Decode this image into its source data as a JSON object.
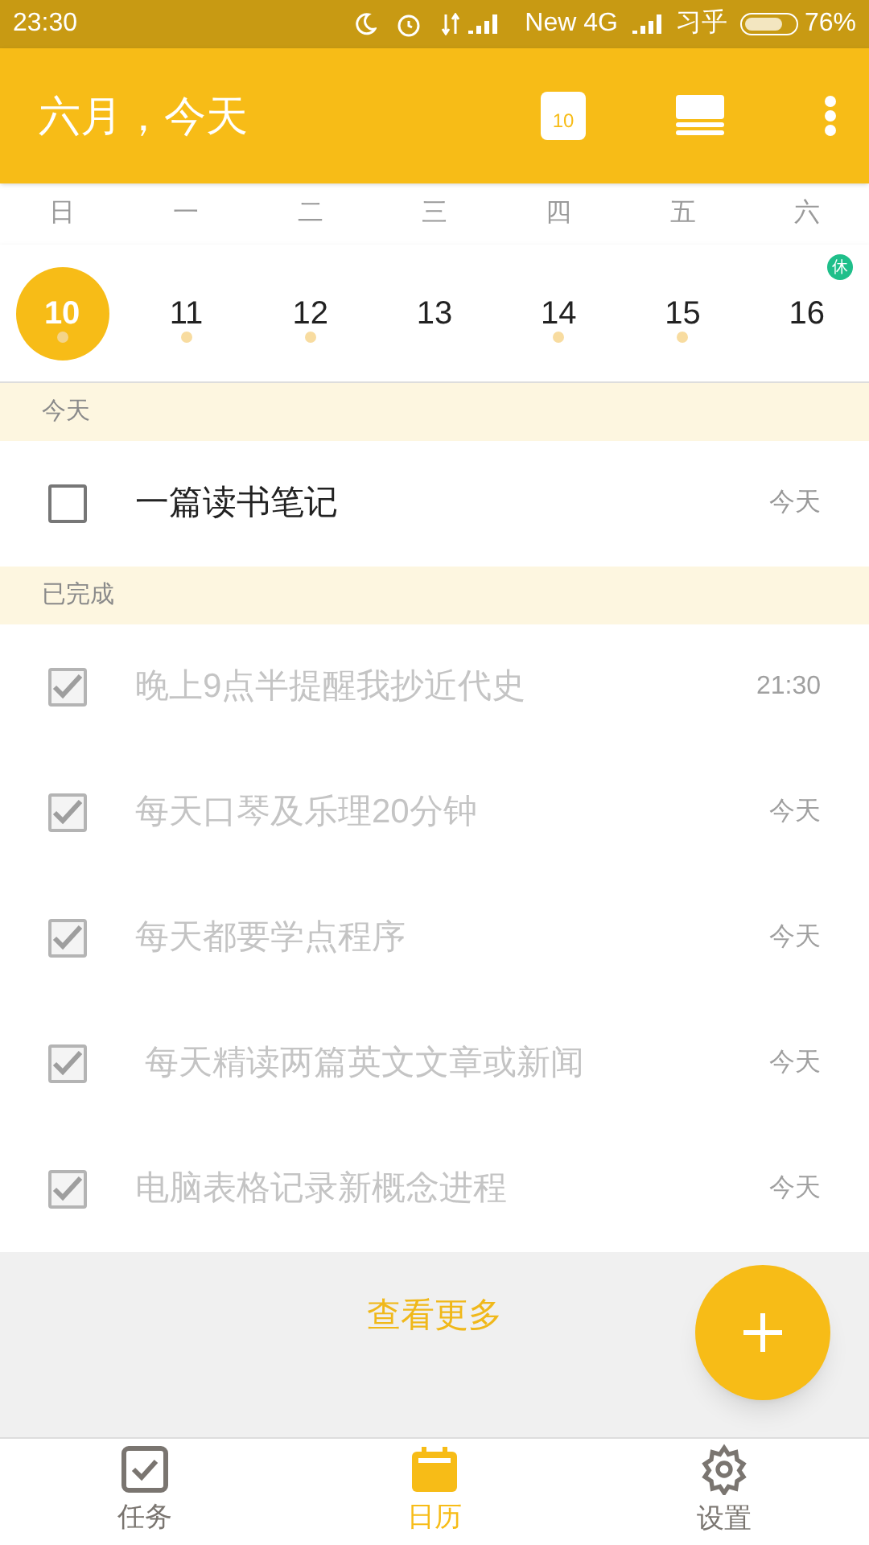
{
  "status_bar": {
    "time": "23:30",
    "network": "New 4G",
    "carrier": "习乎",
    "battery": "76%"
  },
  "header": {
    "title": "六月，今天",
    "calendar_day": "10"
  },
  "week": {
    "weekdays": [
      "日",
      "一",
      "二",
      "三",
      "四",
      "五",
      "六"
    ],
    "days": [
      {
        "date": "10",
        "selected": true,
        "has_tasks": true
      },
      {
        "date": "11",
        "selected": false,
        "has_tasks": true
      },
      {
        "date": "12",
        "selected": false,
        "has_tasks": true
      },
      {
        "date": "13",
        "selected": false,
        "has_tasks": false
      },
      {
        "date": "14",
        "selected": false,
        "has_tasks": true
      },
      {
        "date": "15",
        "selected": false,
        "has_tasks": true
      },
      {
        "date": "16",
        "selected": false,
        "has_tasks": false,
        "badge": "休"
      }
    ]
  },
  "sections": [
    {
      "title": "今天",
      "tasks": [
        {
          "text": "一篇读书笔记",
          "time": "今天",
          "checked": false
        }
      ]
    },
    {
      "title": "已完成",
      "tasks": [
        {
          "text": "晚上9点半提醒我抄近代史",
          "time": "21:30",
          "checked": true
        },
        {
          "text": "每天口琴及乐理20分钟",
          "time": "今天",
          "checked": true
        },
        {
          "text": "每天都要学点程序",
          "time": "今天",
          "checked": true
        },
        {
          "text": " 每天精读两篇英文文章或新闻",
          "time": "今天",
          "checked": true
        },
        {
          "text": "电脑表格记录新概念进程",
          "time": "今天",
          "checked": true
        }
      ]
    }
  ],
  "more_link": "查看更多",
  "bottom_nav": [
    {
      "label": "任务",
      "kind": "tasks",
      "selected": false
    },
    {
      "label": "日历",
      "kind": "calendar",
      "selected": true
    },
    {
      "label": "设置",
      "kind": "settings",
      "selected": false
    }
  ]
}
